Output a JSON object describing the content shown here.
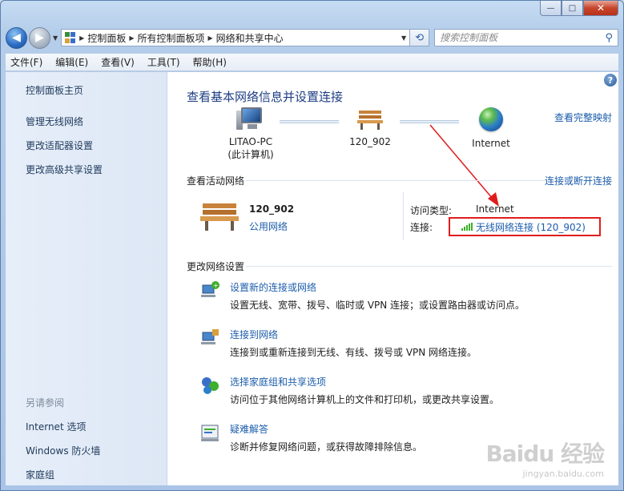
{
  "window": {
    "min_glyph": "—",
    "max_glyph": "□",
    "close_glyph": "✕"
  },
  "address": {
    "crumbs": [
      "控制面板",
      "所有控制面板项",
      "网络和共享中心"
    ],
    "search_placeholder": "搜索控制面板"
  },
  "menu": [
    "文件(F)",
    "编辑(E)",
    "查看(V)",
    "工具(T)",
    "帮助(H)"
  ],
  "sidebar": {
    "home": "控制面板主页",
    "links": [
      "管理无线网络",
      "更改适配器设置",
      "更改高级共享设置"
    ],
    "see_also_title": "另请参阅",
    "see_also": [
      "Internet 选项",
      "Windows 防火墙",
      "家庭组"
    ]
  },
  "main": {
    "title": "查看基本网络信息并设置连接",
    "full_map": "查看完整映射",
    "map": {
      "pc_name": "LITAO-PC",
      "pc_sub": "(此计算机)",
      "network": "120_902",
      "internet": "Internet"
    },
    "active_section": "查看活动网络",
    "connect_link": "连接或断开连接",
    "active_net": {
      "name": "120_902",
      "type": "公用网络",
      "access_label": "访问类型:",
      "access_value": "Internet",
      "conn_label": "连接:",
      "conn_value": "无线网络连接 (120_902)"
    },
    "change_section": "更改网络设置",
    "tasks": [
      {
        "title": "设置新的连接或网络",
        "desc": "设置无线、宽带、拨号、临时或 VPN 连接；或设置路由器或访问点。"
      },
      {
        "title": "连接到网络",
        "desc": "连接到或重新连接到无线、有线、拨号或 VPN 网络连接。"
      },
      {
        "title": "选择家庭组和共享选项",
        "desc": "访问位于其他网络计算机上的文件和打印机，或更改共享设置。"
      },
      {
        "title": "疑难解答",
        "desc": "诊断并修复网络问题，或获得故障排除信息。"
      }
    ]
  },
  "watermark": {
    "logo": "Baidu 经验",
    "url": "jingyan.baidu.com"
  },
  "colors": {
    "link": "#1c5dac",
    "title": "#1e3e84",
    "highlight": "#e01d1d"
  }
}
